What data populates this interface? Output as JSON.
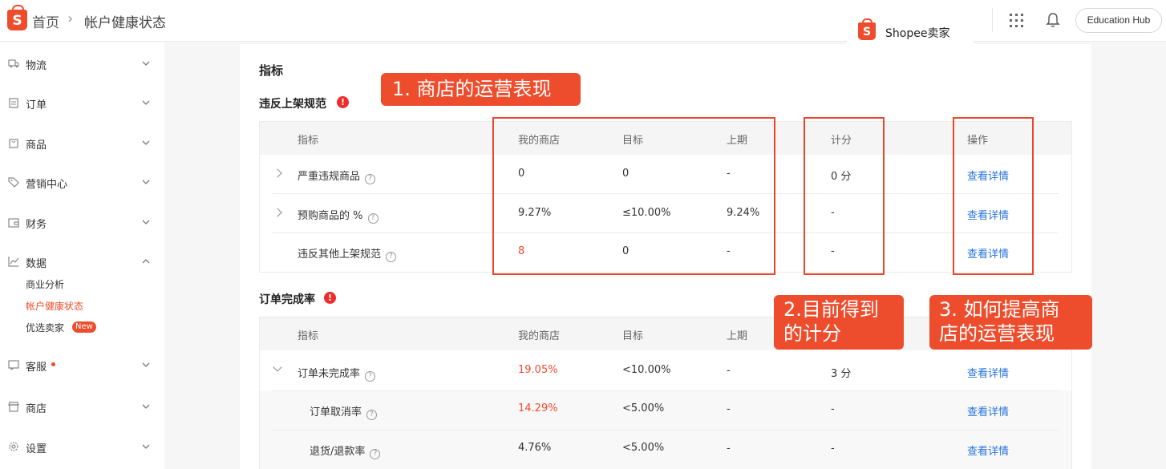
{
  "header": {
    "logo_letter": "S",
    "breadcrumb_home": "首页",
    "breadcrumb_sep": "›",
    "breadcrumb_current": "帐户健康状态",
    "brand_text": "Shopee卖家",
    "education_hub": "Education Hub"
  },
  "sidebar": {
    "items": [
      {
        "label": "物流"
      },
      {
        "label": "订单"
      },
      {
        "label": "商品"
      },
      {
        "label": "营销中心"
      },
      {
        "label": "财务"
      },
      {
        "label": "数据"
      },
      {
        "label": "客服"
      },
      {
        "label": "商店"
      },
      {
        "label": "设置"
      }
    ],
    "data_sub": [
      "商业分析",
      "帐户健康状态",
      "优选卖家"
    ],
    "new_badge": "New"
  },
  "main": {
    "section_title": "指标",
    "group1": {
      "title": "违反上架规范",
      "headers": [
        "指标",
        "我的商店",
        "目标",
        "上期",
        "计分",
        "操作"
      ],
      "rows": [
        {
          "name": "严重违规商品",
          "mine": "0",
          "target": "0",
          "last": "-",
          "score": "0 分",
          "action": "查看详情"
        },
        {
          "name": "预购商品的 %",
          "mine": "9.27%",
          "target": "≤10.00%",
          "last": "9.24%",
          "score": "-",
          "action": "查看详情"
        },
        {
          "name": "违反其他上架规范",
          "mine": "8",
          "target": "0",
          "last": "-",
          "score": "-",
          "action": "查看详情"
        }
      ]
    },
    "group2": {
      "title": "订单完成率",
      "headers": [
        "指标",
        "我的商店",
        "目标",
        "上期"
      ],
      "rows": [
        {
          "name": "订单未完成率",
          "mine": "19.05%",
          "target": "<10.00%",
          "last": "-",
          "score": "3 分",
          "action": "查看详情"
        },
        {
          "name": "订单取消率",
          "mine": "14.29%",
          "target": "<5.00%",
          "last": "-",
          "score": "-",
          "action": "查看详情"
        },
        {
          "name": "退货/退款率",
          "mine": "4.76%",
          "target": "<5.00%",
          "last": "-",
          "score": "-",
          "action": "查看详情"
        }
      ]
    }
  },
  "annotations": {
    "callout1": "1. 商店的运营表现",
    "callout2_line1": "2.目前得到",
    "callout2_line2": "的计分",
    "callout3_line1": "3. 如何提高商",
    "callout3_line2": "店的运营表现"
  },
  "colors": {
    "brand": "#ee4d2d",
    "link": "#2673dd",
    "annotation": "#e8452c"
  }
}
